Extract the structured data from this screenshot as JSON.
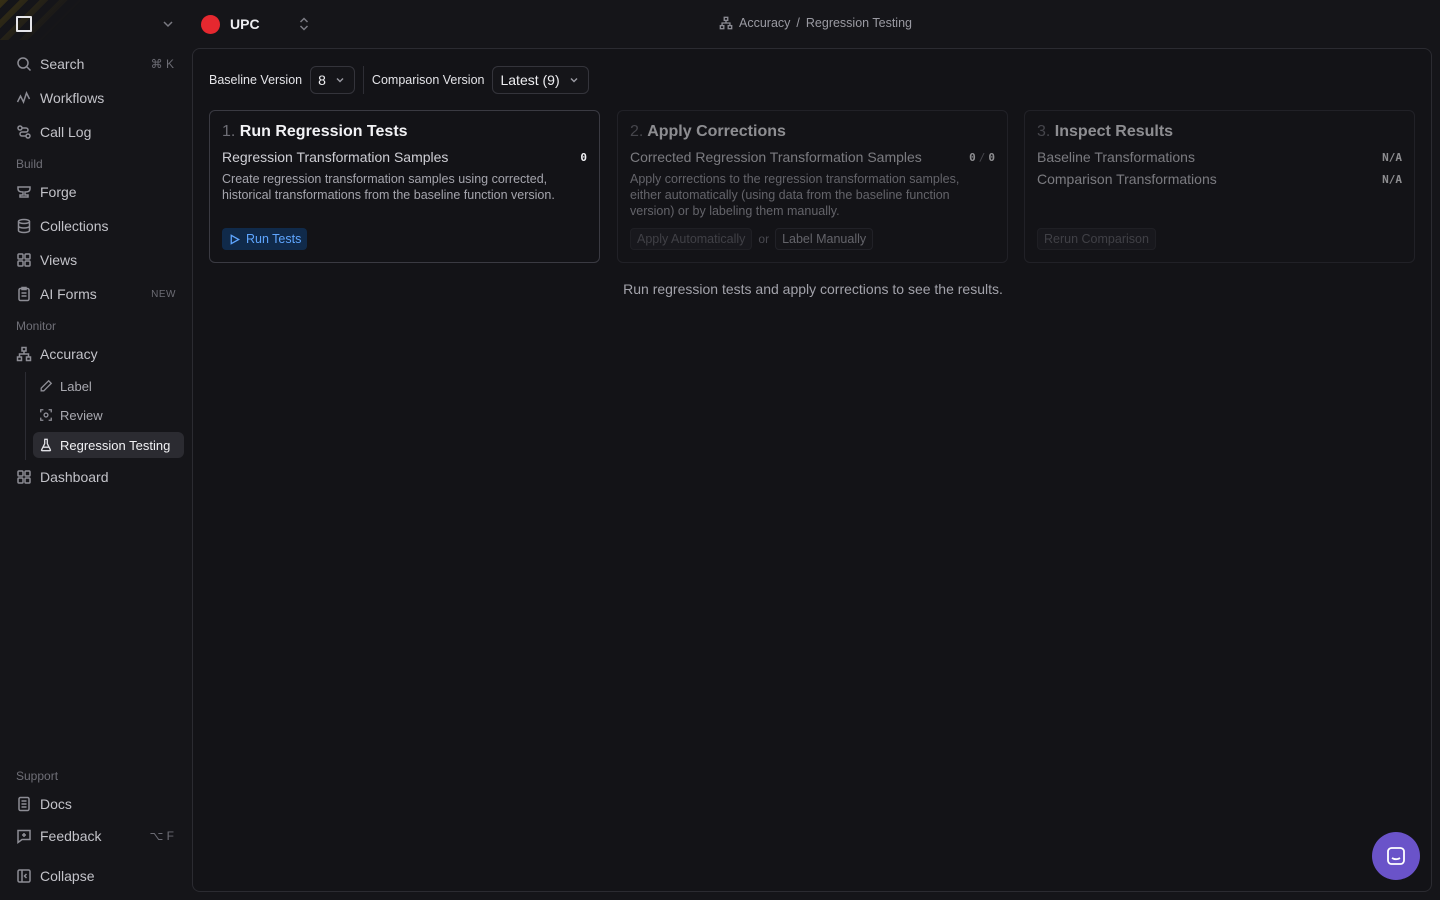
{
  "sidebar": {
    "search": {
      "label": "Search",
      "shortcut": "⌘ K"
    },
    "workflows": "Workflows",
    "call_log": "Call Log",
    "build_label": "Build",
    "forge": "Forge",
    "collections": "Collections",
    "views": "Views",
    "ai_forms": {
      "label": "AI Forms",
      "tag": "NEW"
    },
    "monitor_label": "Monitor",
    "accuracy": "Accuracy",
    "label": "Label",
    "review": "Review",
    "regression_testing": "Regression Testing",
    "dashboard": "Dashboard",
    "support_label": "Support",
    "docs": "Docs",
    "feedback": {
      "label": "Feedback",
      "shortcut": "⌥ F"
    },
    "collapse": "Collapse"
  },
  "header": {
    "project_name": "UPC",
    "project_color": "#e5282f",
    "breadcrumb": {
      "parent": "Accuracy",
      "separator": "/",
      "current": "Regression Testing"
    }
  },
  "versions": {
    "baseline_label": "Baseline Version",
    "baseline_value": "8",
    "comparison_label": "Comparison Version",
    "comparison_value": "Latest (9)"
  },
  "steps": [
    {
      "num": "1.",
      "title": "Run Regression Tests",
      "row_label": "Regression Transformation Samples",
      "row_value": "0",
      "description": "Create regression transformation samples using corrected, historical transformations from the baseline function version.",
      "button": "Run Tests"
    },
    {
      "num": "2.",
      "title": "Apply Corrections",
      "row_label": "Corrected Regression Transformation Samples",
      "row_value_a": "0",
      "row_value_sep": "/",
      "row_value_b": "0",
      "description": "Apply corrections to the regression transformation samples, either automatically (using data from the baseline function version) or by labeling them manually.",
      "button_auto": "Apply Automatically",
      "or": "or",
      "button_manual": "Label Manually"
    },
    {
      "num": "3.",
      "title": "Inspect Results",
      "row1_label": "Baseline Transformations",
      "row1_value": "N/A",
      "row2_label": "Comparison Transformations",
      "row2_value": "N/A",
      "button": "Rerun Comparison"
    }
  ],
  "empty_message": "Run regression tests and apply corrections to see the results.",
  "colors": {
    "accent": "#5fa6ff",
    "chat": "#6a53c9"
  }
}
